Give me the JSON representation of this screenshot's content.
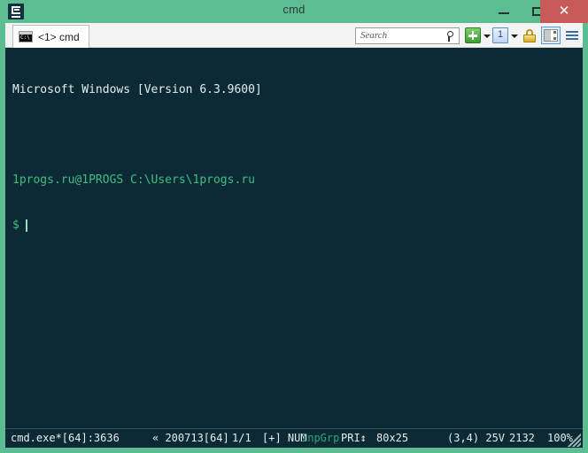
{
  "window": {
    "title": "cmd",
    "app_icon": "conemu-logo-icon",
    "controls": {
      "minimize": "minimize-icon",
      "maximize": "maximize-icon",
      "close": "✕"
    },
    "close_color": "#C85A5A",
    "frame_color": "#5CBC92"
  },
  "tabbar": {
    "tabs": [
      {
        "label": "<1> cmd",
        "icon": "console-window-icon",
        "active": true
      }
    ]
  },
  "toolbar": {
    "search": {
      "placeholder": "Search",
      "value": "",
      "icon": "search-icon"
    },
    "new_console": {
      "icon": "plus-icon",
      "label": ""
    },
    "new_console_dropdown": {
      "icon": "chevron-down-icon"
    },
    "console_group": {
      "icon": "console-group-icon",
      "label": "1"
    },
    "console_group_dropdown": {
      "icon": "chevron-down-icon"
    },
    "lock": {
      "icon": "padlock-icon"
    },
    "panes": {
      "icon": "split-pane-icon",
      "active": true
    },
    "menu": {
      "icon": "hamburger-menu-icon"
    }
  },
  "console": {
    "background": "#0C2A35",
    "text_color": "#E6ECEC",
    "accent_color": "#3FBD7E",
    "lines": [
      {
        "text": "Microsoft Windows [Version 6.3.9600]",
        "style": "white"
      },
      {
        "text": "",
        "style": "blank"
      },
      {
        "text": "1progs.ru@1PROGS C:\\Users\\1progs.ru",
        "style": "green"
      }
    ],
    "prompt": "$",
    "cursor_visible": true
  },
  "statusbar": {
    "process": "cmd.exe*[64]:3636",
    "build": "« 200713[64]",
    "tabs_count": "1/1",
    "flags": "[+] NUM",
    "input_group": "InpGrp",
    "priority": "PRI↕",
    "buffer_size": "80x25",
    "cursor_pos": "(3,4) 25V",
    "pid_or_mem": "2132",
    "zoom": "100%",
    "grip": "resize-grip-icon"
  }
}
